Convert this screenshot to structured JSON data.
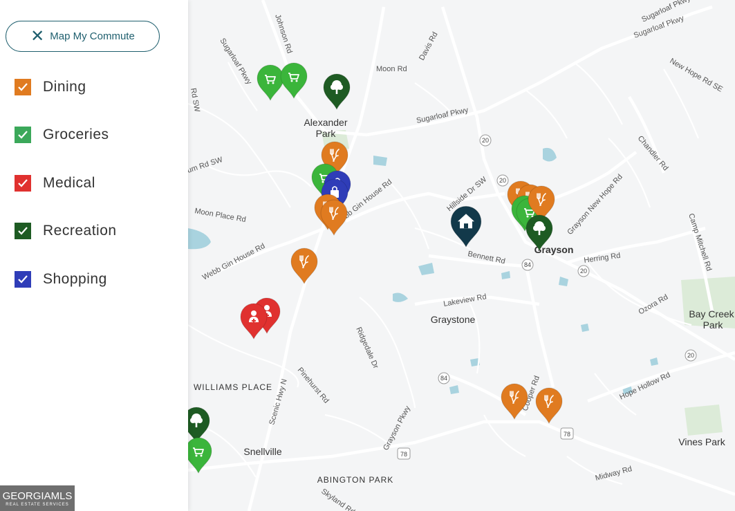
{
  "panel": {
    "commute_button": "Map My Commute",
    "filters": [
      {
        "label": "Dining",
        "color": "#e07b20",
        "checked": true
      },
      {
        "label": "Groceries",
        "color": "#3ba85a",
        "checked": true
      },
      {
        "label": "Medical",
        "color": "#e0312f",
        "checked": true
      },
      {
        "label": "Recreation",
        "color": "#1e5b23",
        "checked": true
      },
      {
        "label": "Shopping",
        "color": "#2f3db8",
        "checked": true
      }
    ]
  },
  "logo": {
    "text": "GEORGIAMLS",
    "subtext": "REAL ESTATE SERVICES"
  },
  "map": {
    "places": {
      "alexander_park_1": "Alexander",
      "alexander_park_2": "Park",
      "grayson": "Grayson",
      "graystone": "Graystone",
      "bay_creek_1": "Bay Creek",
      "bay_creek_2": "Park",
      "williams_place": "WILLIAMS PLACE",
      "snellville": "Snellville",
      "abington_park": "ABINGTON PARK",
      "vines_park": "Vines Park"
    },
    "roads": {
      "johnson_rd": "Johnson Rd",
      "sugarloaf_pkwy_w": "Sugarloaf Pkwy",
      "sugarloaf_pkwy_mid": "Sugarloaf Pkwy",
      "sugarloaf_pkwy_ne": "Sugarloaf Pkwy",
      "sugarloaf_pkwy_top": "Sugarloaf Pkwy",
      "davis_rd": "Davis Rd",
      "moon_rd": "Moon Rd",
      "new_hope_rd_se": "New Hope Rd SE",
      "rd_sw_left": "Rd SW",
      "um_rd_sw": "um Rd SW",
      "chandler_rd": "Chandler Rd",
      "webb_gin_house_rd_e": "ebb Gin House Rd",
      "hillside_dr_sw": "Hillside Dr SW",
      "grayson_new_hope_rd": "Grayson New Hope Rd",
      "moon_place_rd": "Moon Place Rd",
      "camp_mitchell_rd": "Camp Mitchell Rd",
      "webb_gin_house_rd_w": "Webb Gin House Rd",
      "bennett_rd": "Bennett Rd",
      "herring_rd": "Herring Rd",
      "lakeview_rd": "Lakeview Rd",
      "ozora_rd": "Ozora Rd",
      "ridgedale_dr": "Ridgedale Dr",
      "pinehurst_rd": "Pinehurst Rd",
      "scenic_hwy_n": "Scenic Hwy N",
      "cooper_rd": "Cooper Rd",
      "hope_hollow_rd": "Hope Hollow Rd",
      "grayson_pkwy": "Grayson Pkwy",
      "midway_rd": "Midway Rd",
      "skyland_rd": "Skyland Rd"
    },
    "shields": {
      "r20_a": "20",
      "r20_b": "20",
      "r20_c": "20",
      "r20_d": "20",
      "r84_a": "84",
      "r84_b": "84",
      "r78_a": "78",
      "r78_b": "78"
    },
    "markers": [
      {
        "category": "grocery",
        "icon": "cart-icon",
        "color": "#3bb53b"
      },
      {
        "category": "grocery",
        "icon": "cart-icon",
        "color": "#3bb53b"
      },
      {
        "category": "recreation",
        "icon": "tree-icon",
        "color": "#1e5b23"
      },
      {
        "category": "dining",
        "icon": "fork-knife-icon",
        "color": "#e07b20"
      },
      {
        "category": "grocery",
        "icon": "cart-icon",
        "color": "#3bb53b"
      },
      {
        "category": "shopping",
        "icon": "bag-icon",
        "color": "#2f3db8"
      },
      {
        "category": "shopping",
        "icon": "bag-icon",
        "color": "#2f3db8"
      },
      {
        "category": "dining",
        "icon": "fork-knife-icon",
        "color": "#e07b20"
      },
      {
        "category": "dining",
        "icon": "fork-knife-icon",
        "color": "#e07b20"
      },
      {
        "category": "dining",
        "icon": "fork-knife-icon",
        "color": "#e07b20"
      },
      {
        "category": "medical",
        "icon": "medical-icon",
        "color": "#e0312f"
      },
      {
        "category": "medical",
        "icon": "medical-icon",
        "color": "#e0312f"
      },
      {
        "category": "home",
        "icon": "home-icon",
        "color": "#12394a"
      },
      {
        "category": "dining",
        "icon": "fork-knife-icon",
        "color": "#e07b20"
      },
      {
        "category": "dining",
        "icon": "fork-knife-icon",
        "color": "#e07b20"
      },
      {
        "category": "grocery",
        "icon": "cart-icon",
        "color": "#3bb53b"
      },
      {
        "category": "grocery",
        "icon": "cart-icon",
        "color": "#3bb53b"
      },
      {
        "category": "dining",
        "icon": "fork-knife-icon",
        "color": "#e07b20"
      },
      {
        "category": "recreation",
        "icon": "tree-icon",
        "color": "#1e5b23"
      },
      {
        "category": "dining",
        "icon": "fork-knife-icon",
        "color": "#e07b20"
      },
      {
        "category": "dining",
        "icon": "fork-knife-icon",
        "color": "#e07b20"
      },
      {
        "category": "recreation",
        "icon": "tree-icon",
        "color": "#1e5b23"
      },
      {
        "category": "grocery",
        "icon": "cart-icon",
        "color": "#3bb53b"
      }
    ]
  }
}
